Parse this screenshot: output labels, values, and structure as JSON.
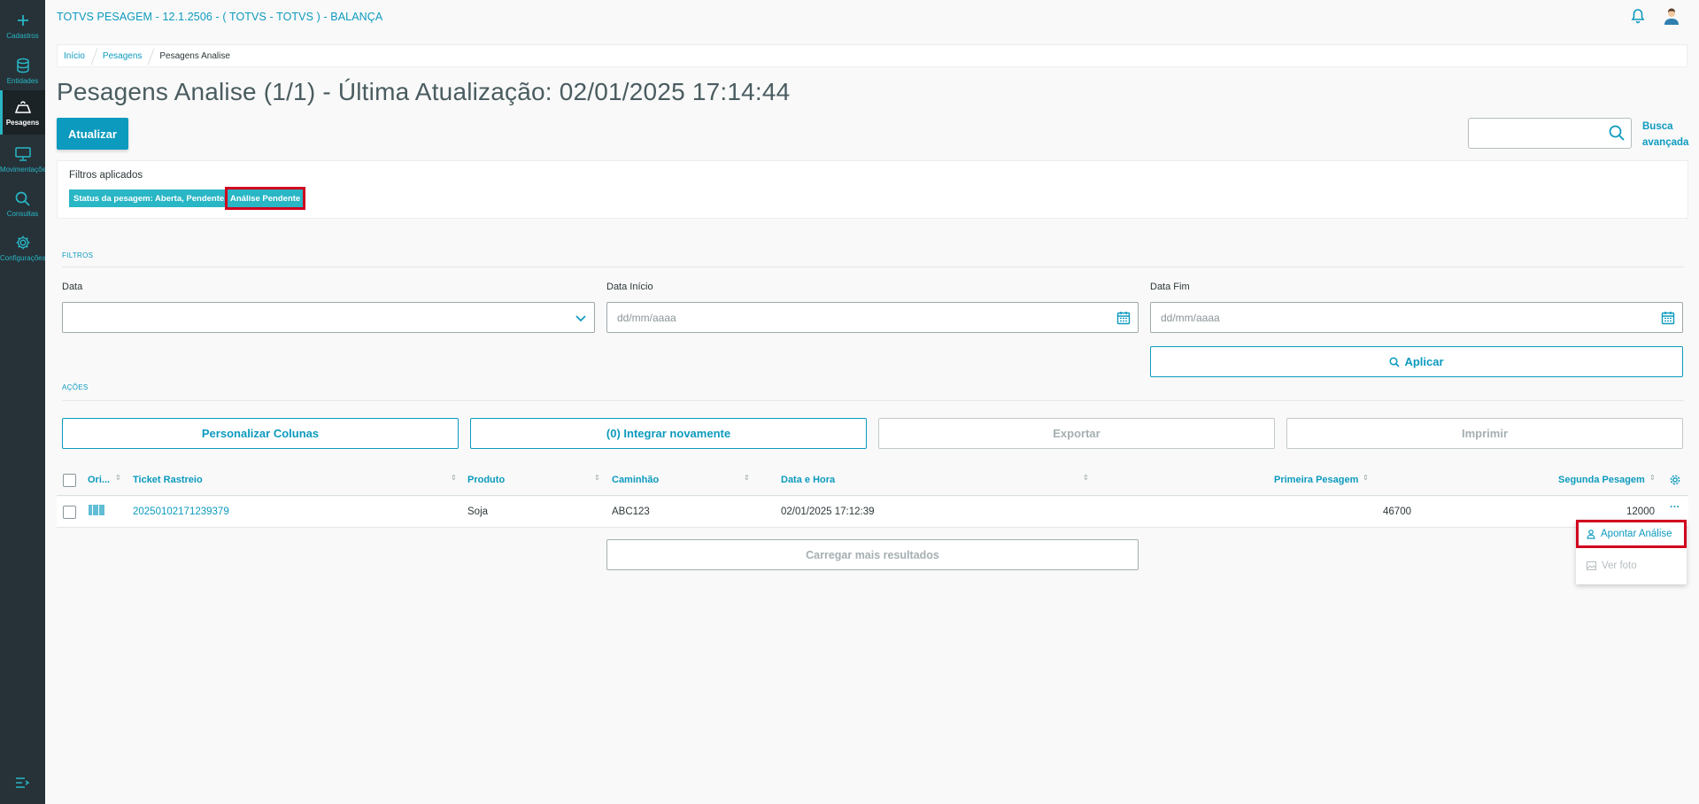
{
  "app": {
    "title": "TOTVS PESAGEM - 12.1.2506 - ( TOTVS - TOTVS ) - BALANÇA"
  },
  "sidebar": {
    "items": [
      {
        "label": "Cadastros",
        "icon": "plus-icon"
      },
      {
        "label": "Entidades",
        "icon": "database-icon"
      },
      {
        "label": "Pesagens",
        "icon": "scale-icon",
        "active": true
      },
      {
        "label": "Movimentações",
        "icon": "monitor-icon"
      },
      {
        "label": "Consultas",
        "icon": "search-icon"
      },
      {
        "label": "Configurações",
        "icon": "gear-icon"
      }
    ]
  },
  "breadcrumb": [
    "Início",
    "Pesagens",
    "Pesagens Analise"
  ],
  "page": {
    "title": "Pesagens Analise (1/1) - Última Atualização: 02/01/2025 17:14:44",
    "refresh_label": "Atualizar",
    "search_placeholder": "",
    "advanced_search_line1": "Busca",
    "advanced_search_line2": "avançada"
  },
  "applied_filters": {
    "title": "Filtros aplicados",
    "chip1": "Status da pesagem: Aberta, Pendente,",
    "chip2": "Análise Pendente"
  },
  "filters": {
    "section_label": "FILTROS",
    "data_label": "Data",
    "data_value": "",
    "start_label": "Data Início",
    "start_placeholder": "dd/mm/aaaa",
    "end_label": "Data Fim",
    "end_placeholder": "dd/mm/aaaa",
    "apply_label": "Aplicar"
  },
  "actions": {
    "section_label": "AÇÕES",
    "customize_columns": "Personalizar Colunas",
    "reintegrate": "(0) Integrar novamente",
    "export": "Exportar",
    "print": "Imprimir"
  },
  "table": {
    "columns": [
      "Ori...",
      "Ticket Rastreio",
      "Produto",
      "Caminhão",
      "Data e Hora",
      "Primeira Pesagem",
      "Segunda Pesagem"
    ],
    "rows": [
      {
        "ticket": "20250102171239379",
        "produto": "Soja",
        "caminhao": "ABC123",
        "data_hora": "02/01/2025 17:12:39",
        "primeira": "46700",
        "segunda": "12000"
      }
    ],
    "row_more": "···",
    "load_more": "Carregar mais resultados"
  },
  "row_menu": {
    "item1": "Apontar Análise",
    "item2": "Ver foto"
  },
  "colors": {
    "primary": "#0c9abe",
    "chip": "#29b6c5",
    "sidebar": "#263238",
    "highlight": "#d1001e"
  }
}
